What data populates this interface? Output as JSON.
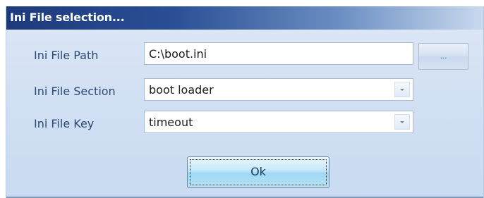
{
  "window": {
    "title": "Ini File selection..."
  },
  "form": {
    "path": {
      "label": "Ini File Path",
      "value": "C:\\boot.ini"
    },
    "section": {
      "label": "Ini File Section",
      "value": "boot loader"
    },
    "key": {
      "label": "Ini File Key",
      "value": "timeout"
    }
  },
  "buttons": {
    "browse_label": "...",
    "ok_label": "Ok"
  },
  "icons": {
    "combo_arrow": "chevron-down-icon"
  }
}
